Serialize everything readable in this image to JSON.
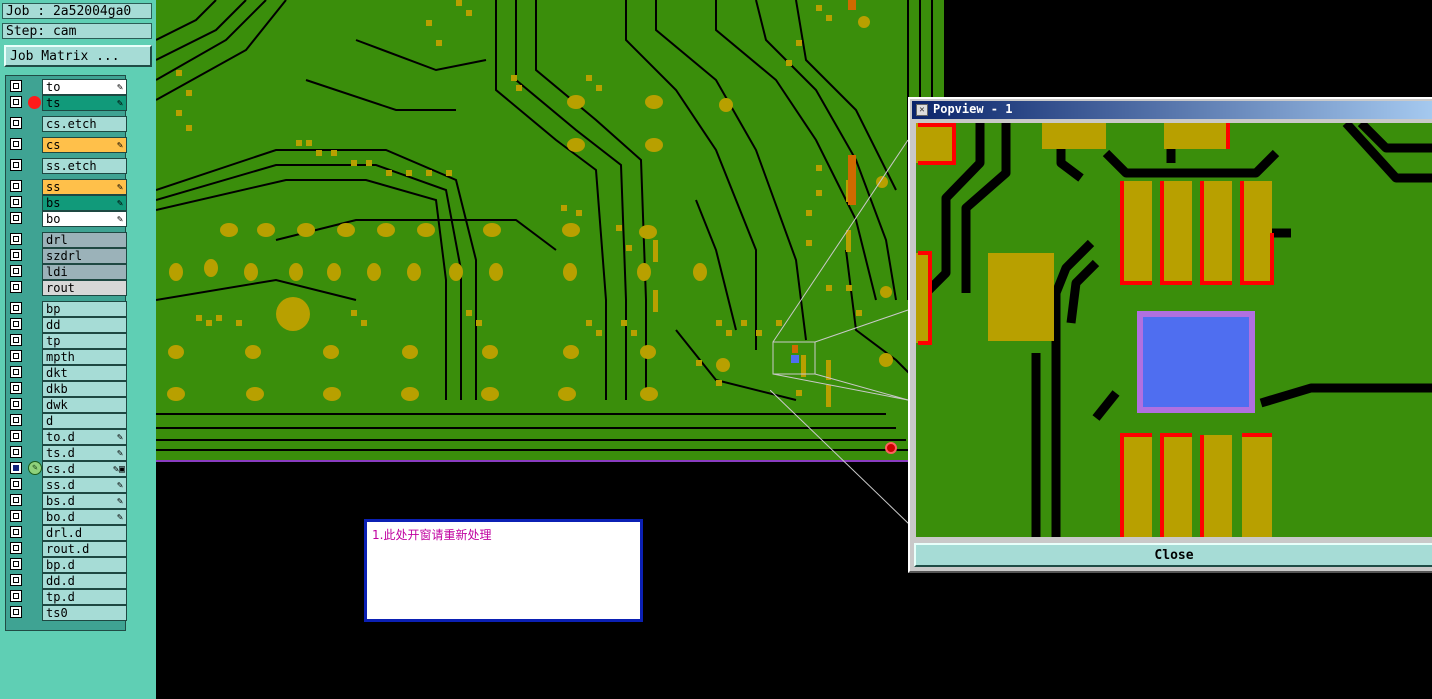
{
  "header": {
    "job_label": "Job : 2a52004ga0",
    "step_label": "Step: cam"
  },
  "job_matrix_button": "Job Matrix ...",
  "layers": [
    {
      "name": "to",
      "color": "#ffffff",
      "marker": "✎",
      "indicator": "none"
    },
    {
      "name": "ts",
      "color": "#119a7a",
      "marker": "✎",
      "indicator": "red-dot"
    },
    {
      "name": "cs.etch",
      "color": "#a6dcd6",
      "marker": "",
      "indicator": "none"
    },
    {
      "name": "cs",
      "color": "#ffc04a",
      "marker": "✎",
      "indicator": "none"
    },
    {
      "name": "ss.etch",
      "color": "#a6dcd6",
      "marker": "",
      "indicator": "none"
    },
    {
      "name": "ss",
      "color": "#ffc04a",
      "marker": "✎",
      "indicator": "none"
    },
    {
      "name": "bs",
      "color": "#119a7a",
      "marker": "✎",
      "indicator": "none"
    },
    {
      "name": "bo",
      "color": "#ffffff",
      "marker": "✎",
      "indicator": "none"
    },
    {
      "name": "drl",
      "color": "#9bb2b9",
      "marker": "",
      "indicator": "none"
    },
    {
      "name": "szdrl",
      "color": "#9bb2b9",
      "marker": "",
      "indicator": "none"
    },
    {
      "name": "ldi",
      "color": "#9bb2b9",
      "marker": "",
      "indicator": "none"
    },
    {
      "name": "rout",
      "color": "#d7d7d7",
      "marker": "",
      "indicator": "none"
    },
    {
      "name": "bp",
      "color": "#a6dcd6",
      "marker": "",
      "indicator": "none"
    },
    {
      "name": "dd",
      "color": "#a6dcd6",
      "marker": "",
      "indicator": "none"
    },
    {
      "name": "tp",
      "color": "#a6dcd6",
      "marker": "",
      "indicator": "none"
    },
    {
      "name": "mpth",
      "color": "#a6dcd6",
      "marker": "",
      "indicator": "none"
    },
    {
      "name": "dkt",
      "color": "#a6dcd6",
      "marker": "",
      "indicator": "none"
    },
    {
      "name": "dkb",
      "color": "#a6dcd6",
      "marker": "",
      "indicator": "none"
    },
    {
      "name": "dwk",
      "color": "#a6dcd6",
      "marker": "",
      "indicator": "none"
    },
    {
      "name": "d",
      "color": "#a6dcd6",
      "marker": "",
      "indicator": "none"
    },
    {
      "name": "to.d",
      "color": "#a6dcd6",
      "marker": "✎",
      "indicator": "none"
    },
    {
      "name": "ts.d",
      "color": "#a6dcd6",
      "marker": "✎",
      "indicator": "none"
    },
    {
      "name": "cs.d",
      "color": "#a6dcd6",
      "marker": "✎▣",
      "indicator": "edit"
    },
    {
      "name": "ss.d",
      "color": "#a6dcd6",
      "marker": "✎",
      "indicator": "none"
    },
    {
      "name": "bs.d",
      "color": "#a6dcd6",
      "marker": "✎",
      "indicator": "none"
    },
    {
      "name": "bo.d",
      "color": "#a6dcd6",
      "marker": "✎",
      "indicator": "none"
    },
    {
      "name": "drl.d",
      "color": "#a6dcd6",
      "marker": "",
      "indicator": "none"
    },
    {
      "name": "rout.d",
      "color": "#a6dcd6",
      "marker": "",
      "indicator": "none"
    },
    {
      "name": "bp.d",
      "color": "#a6dcd6",
      "marker": "",
      "indicator": "none"
    },
    {
      "name": "dd.d",
      "color": "#a6dcd6",
      "marker": "",
      "indicator": "none"
    },
    {
      "name": "tp.d",
      "color": "#a6dcd6",
      "marker": "",
      "indicator": "none"
    },
    {
      "name": "ts0",
      "color": "#a6dcd6",
      "marker": "",
      "indicator": "none"
    }
  ],
  "note": {
    "text": "1.此处开窗请重新处理"
  },
  "popview": {
    "title": "Popview - 1",
    "close_label": "Close"
  },
  "colors": {
    "board": "#3a8e0b",
    "copper": "#b8a000",
    "trace": "#000000",
    "highlight": "#ff0000",
    "selected_pad": "#4f6ef0",
    "selected_pad_edge": "#b070e0"
  }
}
